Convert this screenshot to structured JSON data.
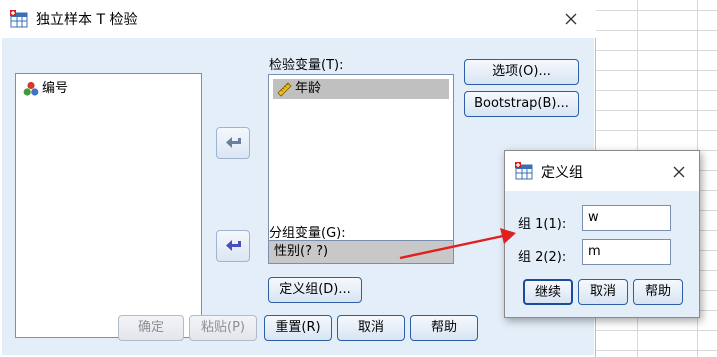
{
  "main_dialog": {
    "title": "独立样本 T 检验",
    "source_list": {
      "items": [
        {
          "label": "编号",
          "icon": "nominal-variable-icon"
        }
      ]
    },
    "test_variables": {
      "label": "检验变量(T):",
      "items": [
        {
          "label": "年龄",
          "icon": "scale-ruler-icon",
          "selected": true
        }
      ]
    },
    "grouping_variable": {
      "label": "分组变量(G):",
      "value": "性别(? ?)"
    },
    "buttons": {
      "options": "选项(O)...",
      "bootstrap": "Bootstrap(B)...",
      "define_groups": "定义组(D)...",
      "ok": "确定",
      "paste": "粘贴(P)",
      "reset": "重置(R)",
      "cancel": "取消",
      "help": "帮助"
    },
    "disabled_buttons": [
      "ok",
      "paste"
    ]
  },
  "define_groups_dialog": {
    "title": "定义组",
    "group1": {
      "label": "组 1(1):",
      "value": "w"
    },
    "group2": {
      "label": "组 2(2):",
      "value": "m"
    },
    "buttons": {
      "continue": "继续",
      "cancel": "取消",
      "help": "帮助"
    }
  },
  "colors": {
    "dialog_body": "#e4eef9",
    "button_border": "#2c5fa8",
    "selected_item": "#c0c0c0",
    "annotation_arrow": "#e02020"
  }
}
